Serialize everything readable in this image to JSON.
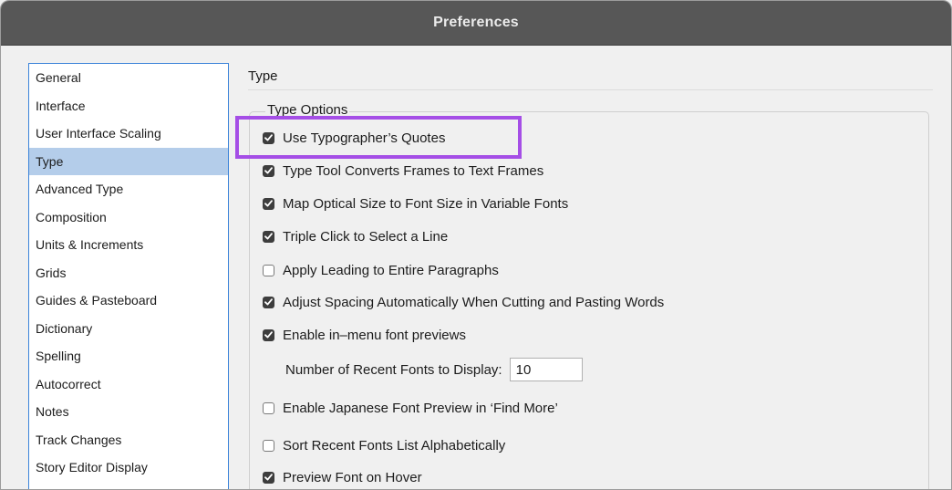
{
  "window": {
    "title": "Preferences"
  },
  "sidebar": {
    "items": [
      {
        "label": "General",
        "selected": false
      },
      {
        "label": "Interface",
        "selected": false
      },
      {
        "label": "User Interface Scaling",
        "selected": false
      },
      {
        "label": "Type",
        "selected": true
      },
      {
        "label": "Advanced Type",
        "selected": false
      },
      {
        "label": "Composition",
        "selected": false
      },
      {
        "label": "Units & Increments",
        "selected": false
      },
      {
        "label": "Grids",
        "selected": false
      },
      {
        "label": "Guides & Pasteboard",
        "selected": false
      },
      {
        "label": "Dictionary",
        "selected": false
      },
      {
        "label": "Spelling",
        "selected": false
      },
      {
        "label": "Autocorrect",
        "selected": false
      },
      {
        "label": "Notes",
        "selected": false
      },
      {
        "label": "Track Changes",
        "selected": false
      },
      {
        "label": "Story Editor Display",
        "selected": false
      }
    ]
  },
  "panel": {
    "title": "Type",
    "group_label": "Type Options",
    "options": [
      {
        "label": "Use Typographer’s Quotes",
        "checked": true
      },
      {
        "label": "Type Tool Converts Frames to Text Frames",
        "checked": true
      },
      {
        "label": "Map Optical Size to Font Size in Variable Fonts",
        "checked": true
      },
      {
        "label": "Triple Click to Select a Line",
        "checked": true
      },
      {
        "label": "Apply Leading to Entire Paragraphs",
        "checked": false
      },
      {
        "label": "Adjust Spacing Automatically When Cutting and Pasting Words",
        "checked": true
      },
      {
        "label": "Enable in–menu font previews",
        "checked": true
      },
      {
        "label": "Enable Japanese Font Preview in ‘Find More’",
        "checked": false
      },
      {
        "label": "Sort Recent Fonts List Alphabetically",
        "checked": false
      },
      {
        "label": "Preview Font on Hover",
        "checked": true
      }
    ],
    "recent_fonts": {
      "label": "Number of Recent Fonts to Display:",
      "value": "10"
    }
  },
  "colors": {
    "titlebar": "#575757",
    "selection": "#b4cdea",
    "sidebar_border": "#3b83d9",
    "highlight": "#a54ee6",
    "checkbox_checked": "#3d3d3d"
  },
  "icons": {
    "checkbox_checked": "checkmark-icon"
  }
}
